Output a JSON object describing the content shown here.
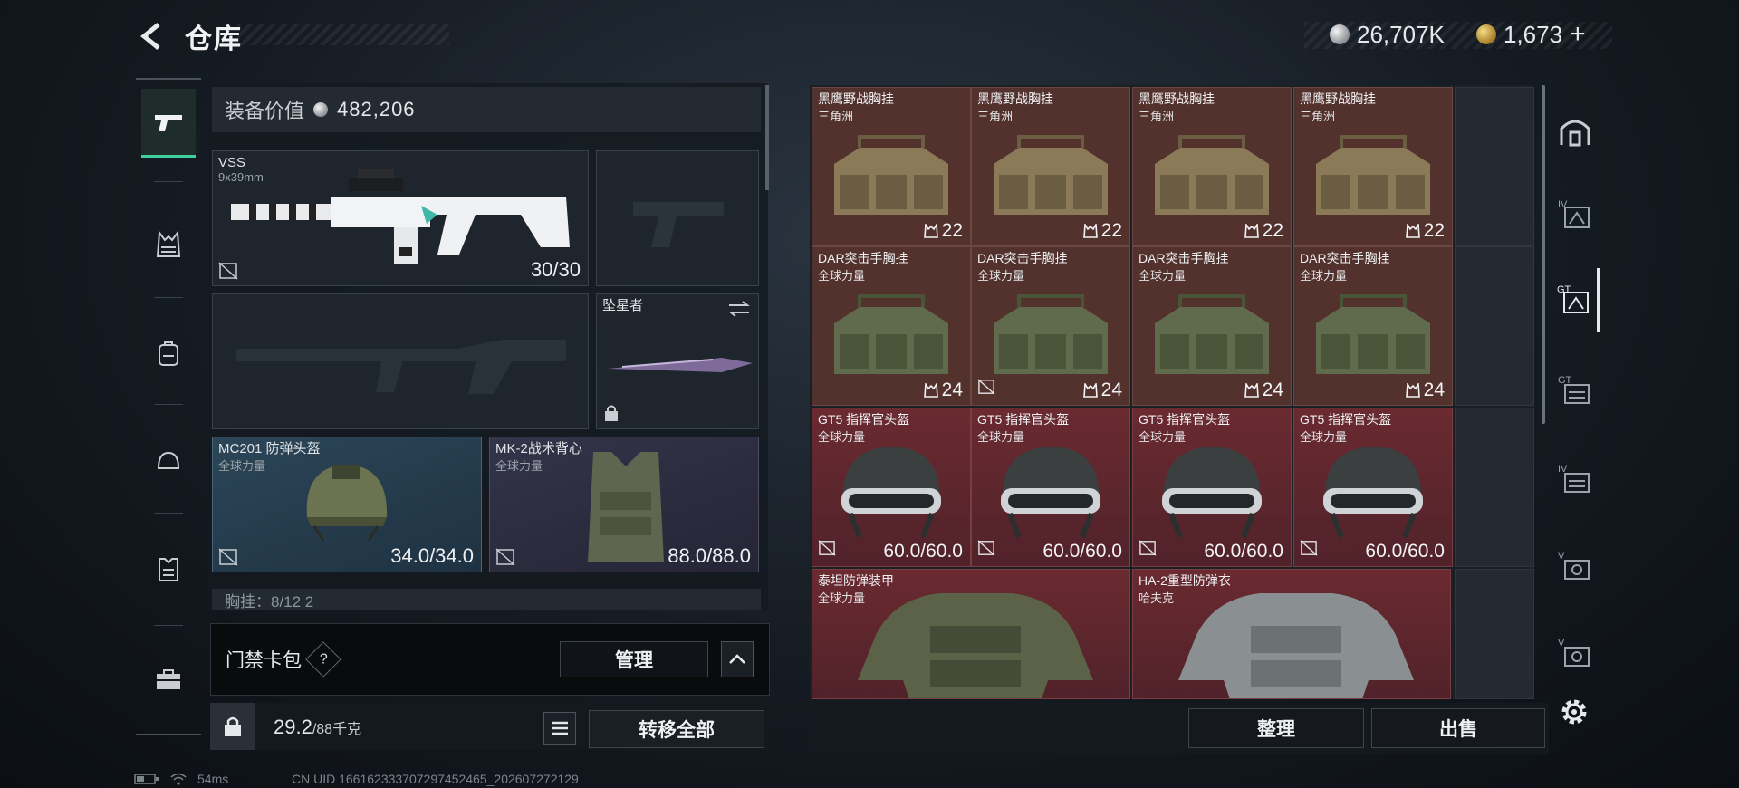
{
  "header": {
    "title": "仓库",
    "currency_silver": "26,707K",
    "currency_gold": "1,673",
    "add_label": "+"
  },
  "equipment": {
    "value_label": "装备价值",
    "value": "482,206",
    "primary_weapon": {
      "name": "VSS",
      "caliber": "9x39mm",
      "ammo": "30/30"
    },
    "melee": {
      "name": "坠星者"
    },
    "helmet": {
      "name": "MC201 防弹头盔",
      "source": "全球力量",
      "durability": "34.0/34.0"
    },
    "armor": {
      "name": "MK-2战术背心",
      "source": "全球力量",
      "durability": "88.0/88.0"
    },
    "chest_rig_row": "胸挂：8/12 2"
  },
  "keycard": {
    "label": "门禁卡包",
    "help": "?",
    "manage_label": "管理"
  },
  "weight": {
    "value": "29.2",
    "max": "/88千克"
  },
  "transfer_label": "转移全部",
  "storage": {
    "row1": [
      {
        "name": "黑鹰野战胸挂",
        "source": "三角洲",
        "count": "22"
      },
      {
        "name": "黑鹰野战胸挂",
        "source": "三角洲",
        "count": "22"
      },
      {
        "name": "黑鹰野战胸挂",
        "source": "三角洲",
        "count": "22"
      },
      {
        "name": "黑鹰野战胸挂",
        "source": "三角洲",
        "count": "22"
      }
    ],
    "row2": [
      {
        "name": "DAR突击手胸挂",
        "source": "全球力量",
        "count": "24"
      },
      {
        "name": "DAR突击手胸挂",
        "source": "全球力量",
        "count": "24"
      },
      {
        "name": "DAR突击手胸挂",
        "source": "全球力量",
        "count": "24"
      },
      {
        "name": "DAR突击手胸挂",
        "source": "全球力量",
        "count": "24"
      }
    ],
    "row3": [
      {
        "name": "GT5 指挥官头盔",
        "source": "全球力量",
        "count": "60.0/60.0"
      },
      {
        "name": "GT5 指挥官头盔",
        "source": "全球力量",
        "count": "60.0/60.0"
      },
      {
        "name": "GT5 指挥官头盔",
        "source": "全球力量",
        "count": "60.0/60.0"
      },
      {
        "name": "GT5 指挥官头盔",
        "source": "全球力量",
        "count": "60.0/60.0"
      }
    ],
    "row4": [
      {
        "name": "泰坦防弹装甲",
        "source": "全球力量"
      },
      {
        "name": "HA-2重型防弹衣",
        "source": "哈夫克"
      }
    ]
  },
  "actions": {
    "sort_label": "整理",
    "sell_label": "出售"
  },
  "status_bar": {
    "ping": "54ms",
    "uid": "CN UID 1661623337072974524​65_202607272129"
  },
  "colors": {
    "accent": "#3fd0a0",
    "rare_red": "#6a2a30",
    "gold_brown": "#53312c"
  }
}
